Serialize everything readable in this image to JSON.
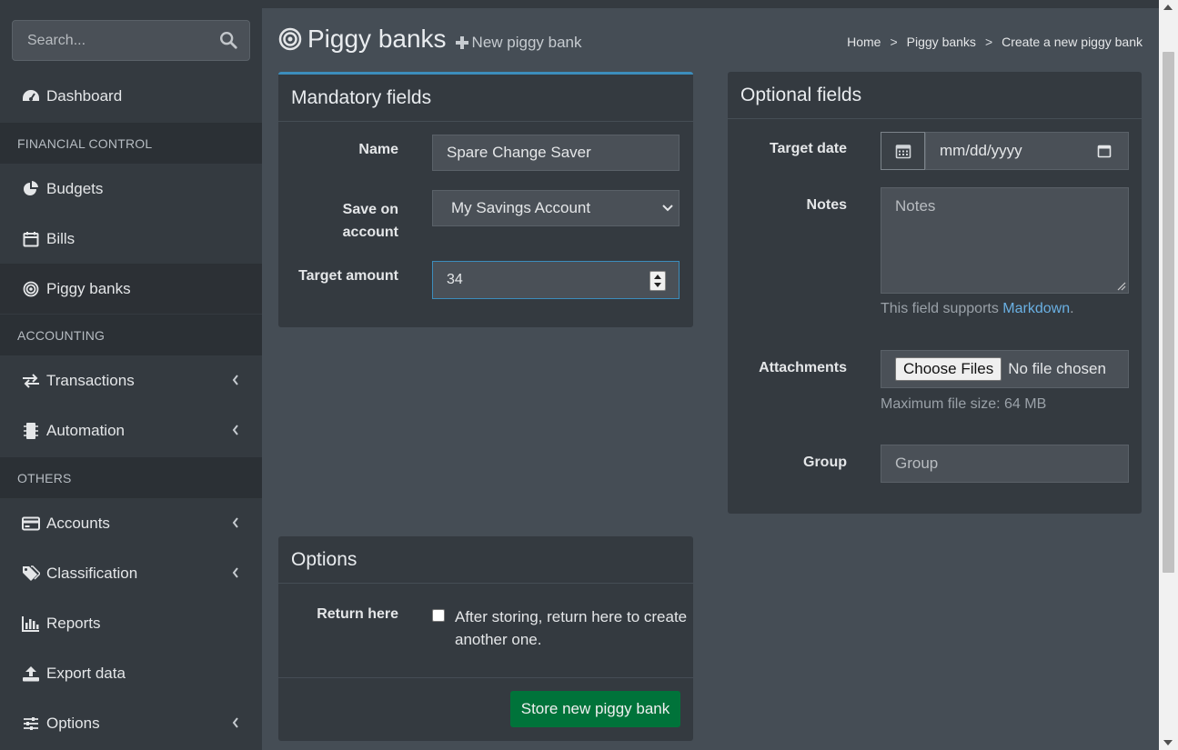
{
  "search": {
    "placeholder": "Search..."
  },
  "sidebar": {
    "dashboard": "Dashboard",
    "financial_header": "FINANCIAL CONTROL",
    "budgets": "Budgets",
    "bills": "Bills",
    "piggy_banks": "Piggy banks",
    "accounting_header": "ACCOUNTING",
    "transactions": "Transactions",
    "automation": "Automation",
    "others_header": "OTHERS",
    "accounts": "Accounts",
    "classification": "Classification",
    "reports": "Reports",
    "export_data": "Export data",
    "options": "Options"
  },
  "header": {
    "title": "Piggy banks",
    "new_link": "New piggy bank",
    "breadcrumb": [
      "Home",
      "Piggy banks",
      "Create a new piggy bank"
    ],
    "breadcrumb_sep": ">"
  },
  "mandatory": {
    "title": "Mandatory fields",
    "name_label": "Name",
    "name_value": "Spare Change Saver",
    "account_label_1": "Save on",
    "account_label_2": "account",
    "account_value": "My Savings Account",
    "amount_label": "Target amount",
    "amount_value": "34"
  },
  "optional": {
    "title": "Optional fields",
    "date_label": "Target date",
    "date_placeholder": "mm/dd/yyyy",
    "notes_label": "Notes",
    "notes_placeholder": "Notes",
    "markdown_help_prefix": "This field supports ",
    "markdown_link": "Markdown",
    "markdown_suffix": ".",
    "attachments_label": "Attachments",
    "choose_files": "Choose Files",
    "no_file": "No file chosen",
    "max_size": "Maximum file size: 64 MB",
    "group_label": "Group",
    "group_placeholder": "Group"
  },
  "options": {
    "title": "Options",
    "return_label": "Return here",
    "return_text_1": "After storing, return here to create",
    "return_text_2": "another one.",
    "submit": "Store new piggy bank"
  },
  "colors": {
    "accent_blue": "#3c8dbc",
    "link": "#6ab0e3",
    "submit_green": "#00733a"
  }
}
